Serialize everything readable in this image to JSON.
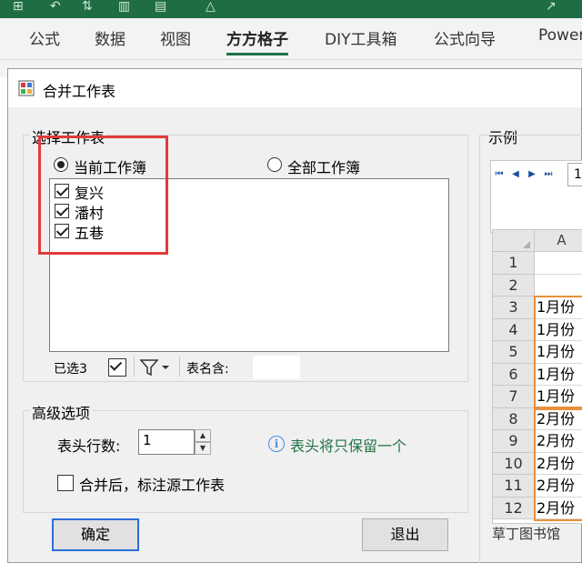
{
  "ribbon": {
    "tabs": [
      {
        "label": "公式"
      },
      {
        "label": "数据"
      },
      {
        "label": "视图"
      },
      {
        "label": "方方格子",
        "active": true
      },
      {
        "label": "DIY工具箱"
      },
      {
        "label": "公式向导"
      },
      {
        "label": "Power"
      }
    ]
  },
  "dialog": {
    "title": "合并工作表",
    "select_group": {
      "legend": "选择工作表",
      "radio_current": "当前工作簿",
      "radio_all": "全部工作簿",
      "selected_radio": "current",
      "sheets": [
        {
          "label": "复兴",
          "checked": true
        },
        {
          "label": "潘村",
          "checked": true
        },
        {
          "label": "五巷",
          "checked": true
        }
      ],
      "selected_count": "已选3",
      "name_filter_label": "表名含:",
      "name_filter_value": ""
    },
    "advanced_group": {
      "legend": "高级选项",
      "header_rows_label": "表头行数:",
      "header_rows_value": "1",
      "info_text": "表头将只保留一个",
      "mark_source_label": "合并后，标注源工作表",
      "mark_source_checked": false
    },
    "buttons": {
      "ok": "确定",
      "exit": "退出"
    },
    "sample": {
      "legend": "示例",
      "column_header": "A",
      "rows": [
        {
          "num": "1",
          "value": ""
        },
        {
          "num": "2",
          "value": ""
        },
        {
          "num": "3",
          "value": "1月份"
        },
        {
          "num": "4",
          "value": "1月份"
        },
        {
          "num": "5",
          "value": "1月份"
        },
        {
          "num": "6",
          "value": "1月份"
        },
        {
          "num": "7",
          "value": "1月份"
        },
        {
          "num": "8",
          "value": "2月份"
        },
        {
          "num": "9",
          "value": "2月份"
        },
        {
          "num": "10",
          "value": "2月份"
        },
        {
          "num": "11",
          "value": "2月份"
        },
        {
          "num": "12",
          "value": "2月份"
        }
      ],
      "tab_fragment": "1"
    }
  },
  "watermark": "草丁图书馆",
  "colors": {
    "accent_green": "#217346",
    "highlight_red": "#e23a3a",
    "highlight_orange": "#e8913a",
    "default_button_border": "#2b6fd6"
  }
}
